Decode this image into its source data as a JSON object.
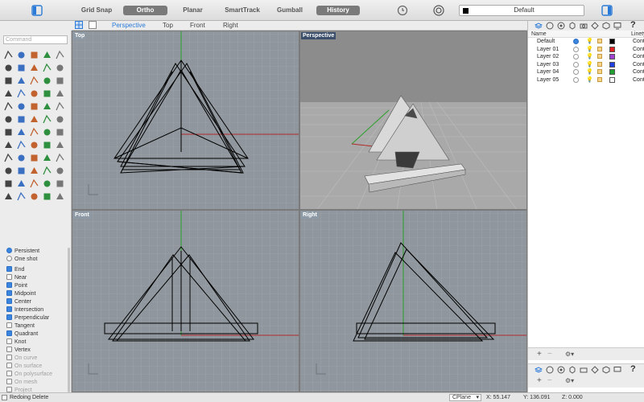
{
  "toolbar": {
    "grid_snap": "Grid Snap",
    "ortho": "Ortho",
    "planar": "Planar",
    "smarttrack": "SmartTrack",
    "gumball": "Gumball",
    "history": "History",
    "current_layer": "Default"
  },
  "view_tabs": [
    "Perspective",
    "Top",
    "Front",
    "Right"
  ],
  "command_placeholder": "Command",
  "osnap": {
    "persistent": "Persistent",
    "one_shot": "One shot",
    "items": [
      {
        "label": "End",
        "checked": true,
        "enabled": true
      },
      {
        "label": "Near",
        "checked": false,
        "enabled": true
      },
      {
        "label": "Point",
        "checked": true,
        "enabled": true
      },
      {
        "label": "Midpoint",
        "checked": true,
        "enabled": true
      },
      {
        "label": "Center",
        "checked": true,
        "enabled": true
      },
      {
        "label": "Intersection",
        "checked": true,
        "enabled": true
      },
      {
        "label": "Perpendicular",
        "checked": true,
        "enabled": true
      },
      {
        "label": "Tangent",
        "checked": false,
        "enabled": true
      },
      {
        "label": "Quadrant",
        "checked": true,
        "enabled": true
      },
      {
        "label": "Knot",
        "checked": false,
        "enabled": true
      },
      {
        "label": "Vertex",
        "checked": false,
        "enabled": true
      },
      {
        "label": "On curve",
        "checked": false,
        "enabled": false
      },
      {
        "label": "On surface",
        "checked": false,
        "enabled": false
      },
      {
        "label": "On polysurface",
        "checked": false,
        "enabled": false
      },
      {
        "label": "On mesh",
        "checked": false,
        "enabled": false
      },
      {
        "label": "Project",
        "checked": false,
        "enabled": false
      }
    ]
  },
  "viewports": {
    "top": "Top",
    "perspective": "Perspective",
    "front": "Front",
    "right": "Right"
  },
  "layers": {
    "col_name": "Name",
    "col_linetype": "Linety",
    "rows": [
      {
        "name": "Default",
        "color": "#000000",
        "current": true,
        "linetype": "Cont"
      },
      {
        "name": "Layer 01",
        "color": "#e02020",
        "current": false,
        "linetype": "Cont"
      },
      {
        "name": "Layer 02",
        "color": "#a040d0",
        "current": false,
        "linetype": "Cont"
      },
      {
        "name": "Layer 03",
        "color": "#2040e0",
        "current": false,
        "linetype": "Cont"
      },
      {
        "name": "Layer 04",
        "color": "#20a030",
        "current": false,
        "linetype": "Cont"
      },
      {
        "name": "Layer 05",
        "color": "#ffffff",
        "current": false,
        "linetype": "Cont"
      }
    ]
  },
  "status": {
    "message": "Redoing Delete",
    "cplane": "CPlane",
    "x": "X: 55.147",
    "y": "Y: 136.091",
    "z": "Z: 0.000"
  },
  "colors": {
    "viewport_bg": "#8f969d",
    "perspective_bg": "#9a9a9a",
    "grid": "#a4abb2",
    "axis_x": "#b02a2a",
    "axis_y": "#2aa02a",
    "accent": "#3a85e0"
  }
}
